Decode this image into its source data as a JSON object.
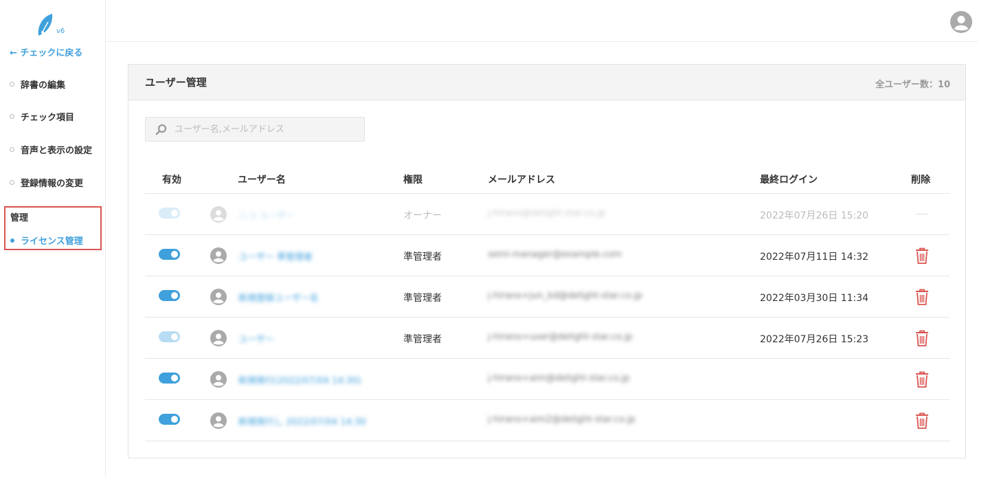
{
  "sidebar": {
    "version": "v6",
    "back_label": "← チェックに戻る",
    "items": [
      {
        "label": "辞書の編集"
      },
      {
        "label": "チェック項目"
      },
      {
        "label": "音声と表示の設定"
      },
      {
        "label": "登録情報の変更"
      }
    ],
    "admin": {
      "title": "管理",
      "item_label": "ライセンス管理"
    }
  },
  "header": {
    "avatar_icon": "user-avatar-icon"
  },
  "panel": {
    "title": "ユーザー管理",
    "count_label": "全ユーザー数：10"
  },
  "search": {
    "placeholder": "ユーザー名,メールアドレス",
    "value": ""
  },
  "table": {
    "columns": [
      "有効",
      "ユーザー名",
      "権限",
      "メールアドレス",
      "最終ログイン",
      "削除"
    ],
    "rows": [
      {
        "enabled": true,
        "toggle_style": "faded",
        "username": "ニコ ユーザー",
        "role": "オーナー",
        "email": "j-hirano@delight-star.co.jp",
        "last_login": "2022年07月26日 15:20",
        "delete": "none",
        "dim": true
      },
      {
        "enabled": true,
        "toggle_style": "normal",
        "username": "ユーザー 準管理者",
        "role": "準管理者",
        "email": "semi-manager@example.com",
        "last_login": "2022年07月11日 14:32",
        "delete": "trash"
      },
      {
        "enabled": true,
        "toggle_style": "normal",
        "username": "新規登録ユーザー名",
        "role": "準管理者",
        "email": "j-hirano+jun_kd@delight-star.co.jp",
        "last_login": "2022年03月30日 11:34",
        "delete": "trash"
      },
      {
        "enabled": true,
        "toggle_style": "light",
        "username": "ユーザー",
        "role": "準管理者",
        "email": "j-hirano+user@delight-star.co.jp",
        "last_login": "2022年07月26日 15:23",
        "delete": "trash"
      },
      {
        "enabled": true,
        "toggle_style": "normal",
        "username": "新規発行(2022/07/04 14:30)",
        "role": "",
        "email": "j-hirano+aim@delight-star.co.jp",
        "last_login": "",
        "delete": "trash"
      },
      {
        "enabled": true,
        "toggle_style": "normal",
        "username": "新規発行し 2022/07/04 14:30",
        "role": "",
        "email": "j-hirano+aim2@delight-star.co.jp",
        "last_login": "",
        "delete": "trash"
      }
    ]
  },
  "colors": {
    "accent": "#3fa0dc",
    "danger": "#d9534f"
  }
}
